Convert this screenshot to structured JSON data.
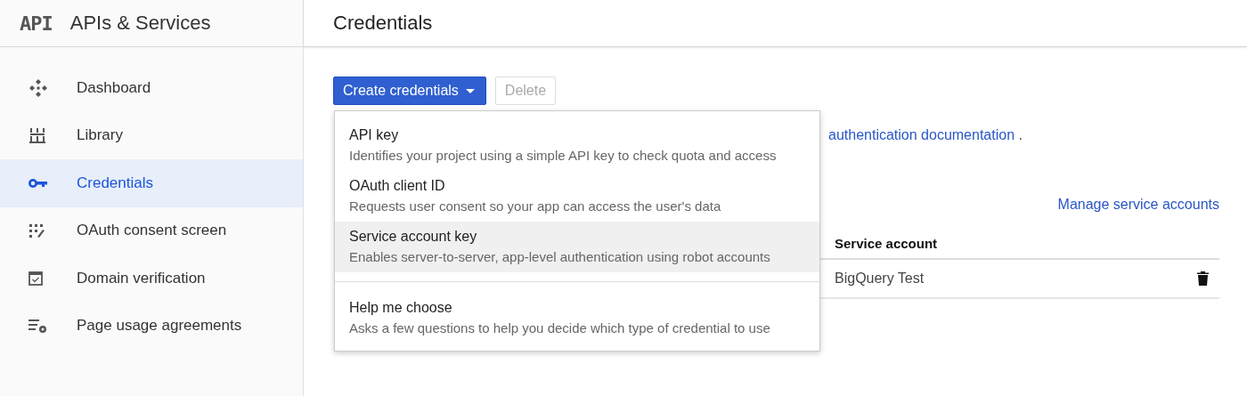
{
  "sidebar": {
    "logo": "API",
    "title": "APIs & Services",
    "items": [
      {
        "label": "Dashboard",
        "kind": "dashboard",
        "selected": false
      },
      {
        "label": "Library",
        "kind": "library",
        "selected": false
      },
      {
        "label": "Credentials",
        "kind": "key",
        "selected": true
      },
      {
        "label": "OAuth consent screen",
        "kind": "consent",
        "selected": false
      },
      {
        "label": "Domain verification",
        "kind": "verify",
        "selected": false
      },
      {
        "label": "Page usage agreements",
        "kind": "agreements",
        "selected": false
      }
    ]
  },
  "page": {
    "title": "Credentials",
    "create_button": "Create credentials",
    "delete_button": {
      "label": "Delete",
      "disabled": true
    },
    "info": {
      "link": "authentication documentation",
      "suffix": "."
    },
    "manage_link": "Manage service accounts",
    "table": {
      "columns": [
        "Service account"
      ],
      "rows": [
        {
          "cells": [
            "BigQuery Test"
          ]
        }
      ]
    },
    "menu": {
      "items": [
        {
          "title": "API key",
          "description": "Identifies your project using a simple API key to check quota and access",
          "highlighted": false,
          "divider_before": false
        },
        {
          "title": "OAuth client ID",
          "description": "Requests user consent so your app can access the user's data",
          "highlighted": false,
          "divider_before": false
        },
        {
          "title": "Service account key",
          "description": "Enables server-to-server, app-level authentication using robot accounts",
          "highlighted": true,
          "divider_before": false
        },
        {
          "title": "Help me choose",
          "description": "Asks a few questions to help you decide which type of credential to use",
          "highlighted": false,
          "divider_before": true
        }
      ]
    }
  }
}
